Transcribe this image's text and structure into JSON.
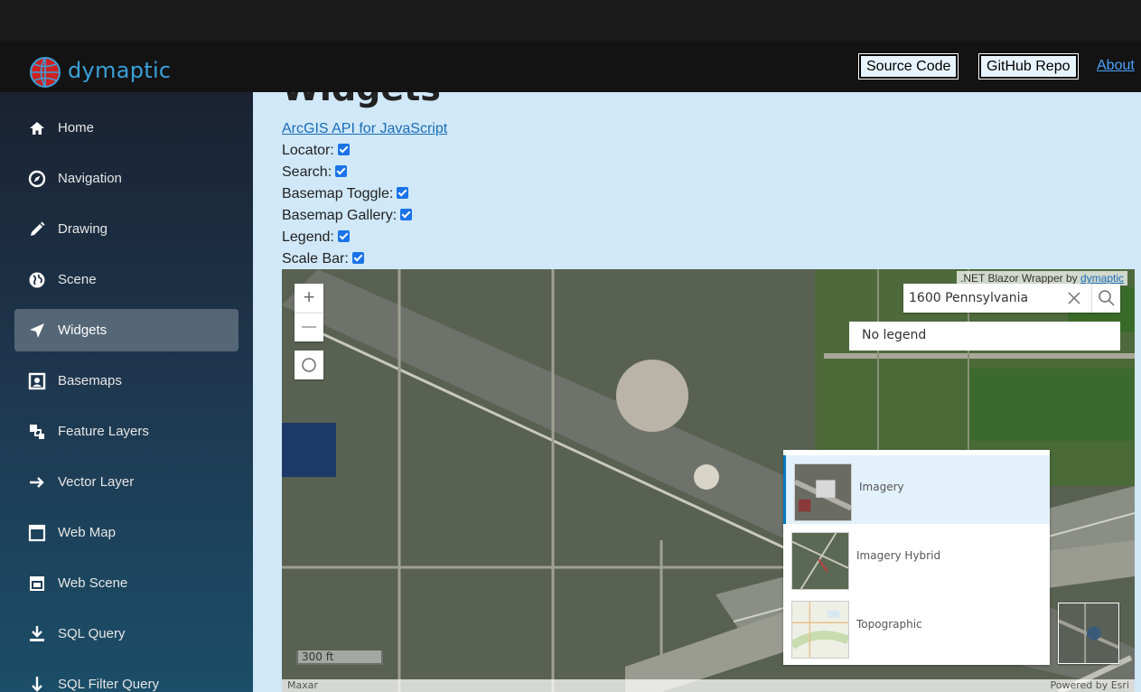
{
  "brand": {
    "name": "dymaptic"
  },
  "header": {
    "source_code": "Source Code",
    "github_repo": "GitHub Repo",
    "about": "About"
  },
  "sidebar": {
    "items": [
      {
        "label": "Home",
        "icon": "home-icon"
      },
      {
        "label": "Navigation",
        "icon": "compass-icon"
      },
      {
        "label": "Drawing",
        "icon": "pencil-icon"
      },
      {
        "label": "Scene",
        "icon": "globe-icon"
      },
      {
        "label": "Widgets",
        "icon": "location-arrow-icon",
        "active": true
      },
      {
        "label": "Basemaps",
        "icon": "image-frame-icon"
      },
      {
        "label": "Feature Layers",
        "icon": "layers-icon"
      },
      {
        "label": "Vector Layer",
        "icon": "arrow-right-icon"
      },
      {
        "label": "Web Map",
        "icon": "window-icon"
      },
      {
        "label": "Web Scene",
        "icon": "browser-icon"
      },
      {
        "label": "SQL Query",
        "icon": "download-icon"
      },
      {
        "label": "SQL Filter Query",
        "icon": "arrow-down-icon"
      }
    ]
  },
  "page": {
    "title": "Widgets",
    "link": "ArcGIS API for JavaScript",
    "checkboxes": [
      {
        "label": "Locator:",
        "checked": true
      },
      {
        "label": "Search:",
        "checked": true
      },
      {
        "label": "Basemap Toggle:",
        "checked": true
      },
      {
        "label": "Basemap Gallery:",
        "checked": true
      },
      {
        "label": "Legend:",
        "checked": true
      },
      {
        "label": "Scale Bar:",
        "checked": true
      }
    ]
  },
  "map": {
    "attribution_top_prefix": ".NET Blazor Wrapper by ",
    "attribution_top_link": "dymaptic",
    "zoom_in": "+",
    "zoom_out": "—",
    "search_value": "1600 Pennsylvania",
    "legend_text": "No legend",
    "gallery": [
      {
        "label": "Imagery",
        "selected": true
      },
      {
        "label": "Imagery Hybrid",
        "selected": false
      },
      {
        "label": "Topographic",
        "selected": false
      }
    ],
    "scale_label": "300 ft",
    "attribution_left": "Maxar",
    "attribution_right": "Powered by Esri"
  },
  "colors": {
    "accent": "#0079c1",
    "link": "#1a6db8",
    "brand": "#3aa0d8"
  }
}
